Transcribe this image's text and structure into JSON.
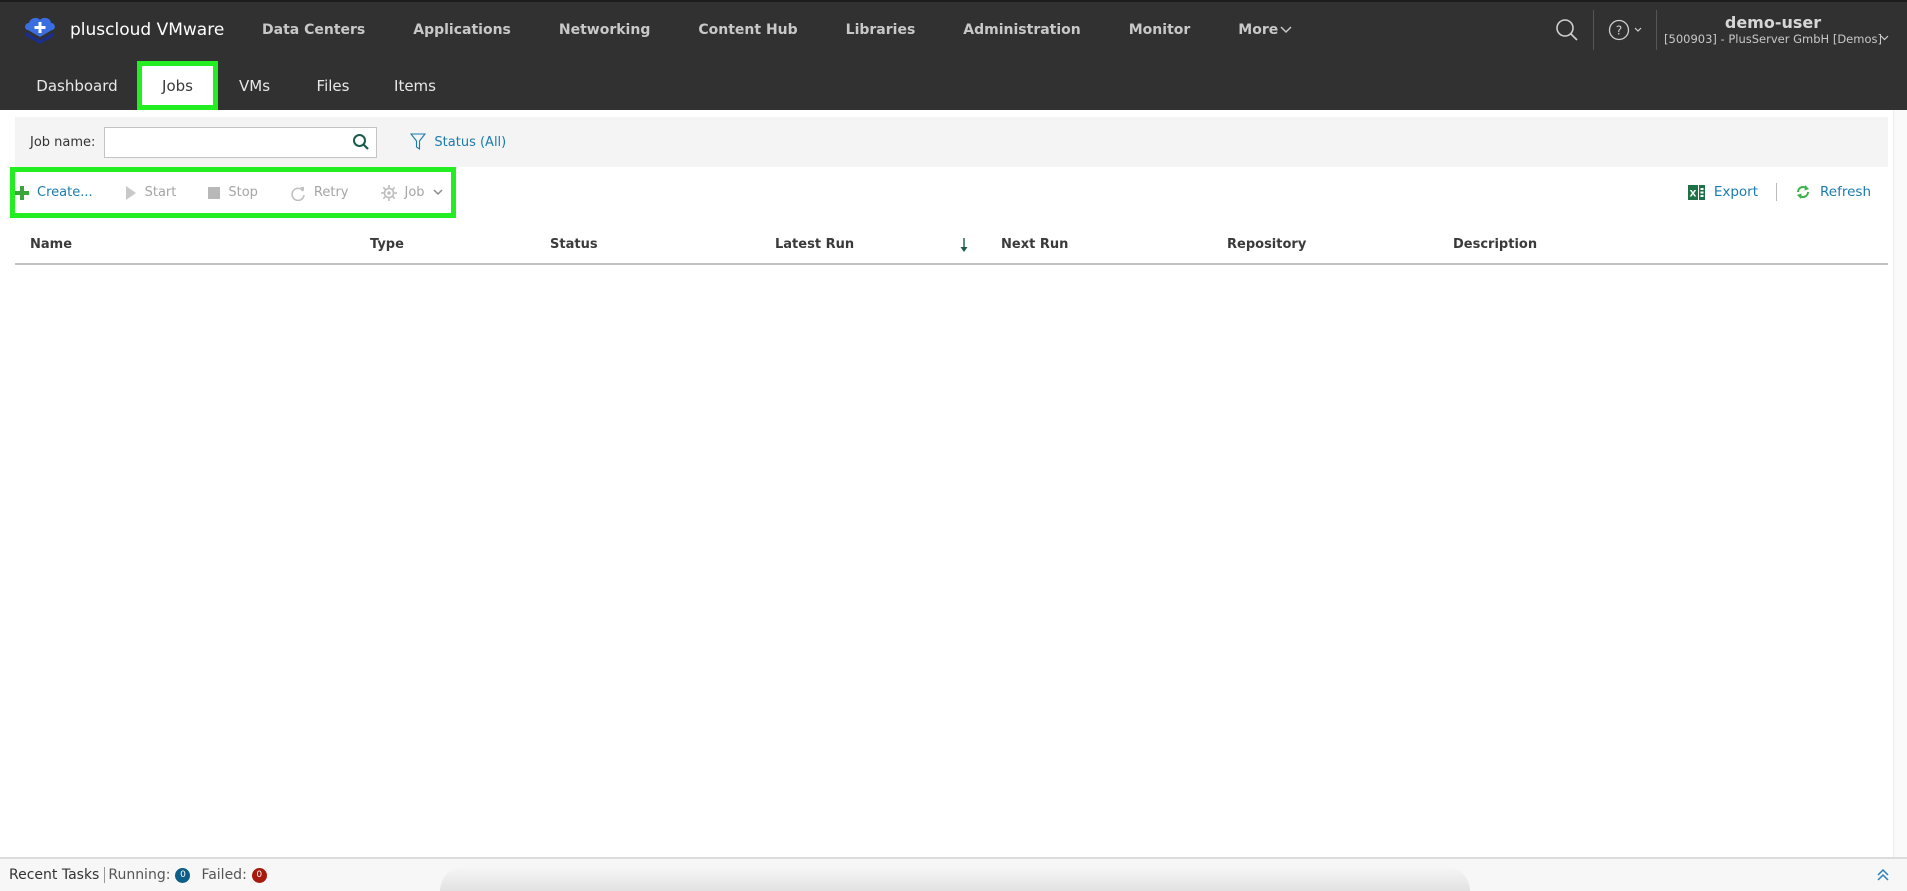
{
  "app": {
    "title": "pluscloud VMware",
    "logo_icon": "cloud-plus-logo-icon"
  },
  "main_nav": {
    "items": [
      {
        "label": "Data Centers"
      },
      {
        "label": "Applications"
      },
      {
        "label": "Networking"
      },
      {
        "label": "Content Hub"
      },
      {
        "label": "Libraries"
      },
      {
        "label": "Administration"
      },
      {
        "label": "Monitor"
      },
      {
        "label": "More"
      }
    ]
  },
  "header_right": {
    "search_icon": "search-icon",
    "help_icon": "help-icon",
    "user_name": "demo-user",
    "org": "[500903] - PlusServer GmbH [Demos]"
  },
  "sub_nav": {
    "tabs": [
      {
        "label": "Dashboard",
        "active": false
      },
      {
        "label": "Jobs",
        "active": true
      },
      {
        "label": "VMs",
        "active": false
      },
      {
        "label": "Files",
        "active": false
      },
      {
        "label": "Items",
        "active": false
      }
    ]
  },
  "filter": {
    "job_name_label": "Job name:",
    "job_name_value": "",
    "job_name_placeholder": "",
    "status_filter_label": "Status (All)"
  },
  "toolbar": {
    "create": "Create...",
    "start": "Start",
    "stop": "Stop",
    "retry": "Retry",
    "job": "Job",
    "export": "Export",
    "refresh": "Refresh"
  },
  "table": {
    "columns": [
      "Name",
      "Type",
      "Status",
      "Latest Run",
      "Next Run",
      "Repository",
      "Description"
    ],
    "sort_column": "Latest Run",
    "sort_direction": "descending",
    "rows": []
  },
  "bottom_bar": {
    "recent_tasks": "Recent Tasks",
    "running_label": "Running:",
    "running_count": "0",
    "failed_label": "Failed:",
    "failed_count": "0"
  },
  "colors": {
    "topbar_bg": "#313131",
    "link_blue": "#1a7cae",
    "highlight_green": "#22ee22",
    "running_badge": "#0e5f87",
    "failed_badge": "#a61b0e",
    "excel_green": "#1e7145",
    "refresh_green": "#3bb34a"
  }
}
